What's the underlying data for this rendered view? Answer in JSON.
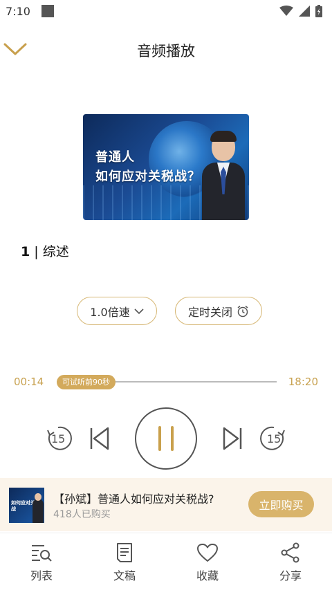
{
  "status_bar": {
    "time": "7:10"
  },
  "header": {
    "title": "音频播放"
  },
  "cover": {
    "line1": "普通人",
    "line2": "如何应对关税战？"
  },
  "episode": {
    "number": "1",
    "separator": " | ",
    "title": "综述"
  },
  "controls": {
    "speed_label": "1.0倍速",
    "timer_label": "定时关闭",
    "rewind_seconds": "15",
    "forward_seconds": "15"
  },
  "progress": {
    "current": "00:14",
    "total": "18:20",
    "trial_label": "可试听前90秒",
    "played_fraction": 0.013
  },
  "purchase": {
    "thumb_text": "如何应对关税战",
    "title": "【孙斌】普通人如何应对关税战?",
    "buyers": "418人已购买",
    "button": "立即购买"
  },
  "tabs": [
    {
      "label": "列表",
      "icon": "list-search-icon"
    },
    {
      "label": "文稿",
      "icon": "document-icon"
    },
    {
      "label": "收藏",
      "icon": "heart-icon"
    },
    {
      "label": "分享",
      "icon": "share-icon"
    }
  ],
  "colors": {
    "accent": "#d3aa5c",
    "accent_border": "#d6b774",
    "banner_bg": "#fbf4ea"
  }
}
